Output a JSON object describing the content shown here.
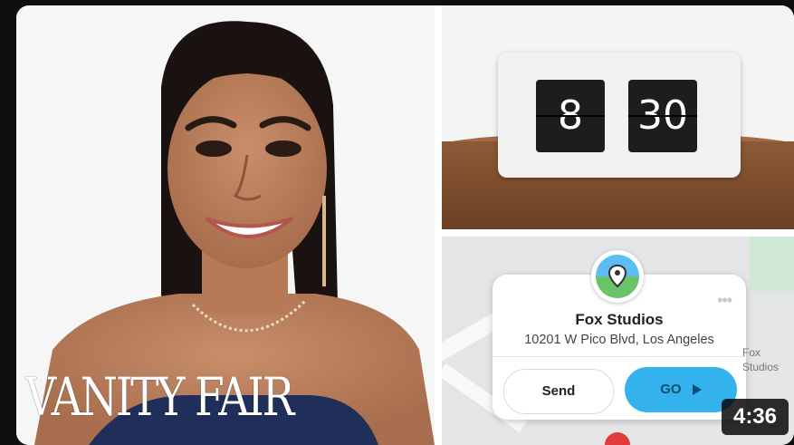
{
  "thumbnail": {
    "logo_text": "VANITY FAIR",
    "duration": "4:36"
  },
  "clock": {
    "hour": "8",
    "minute": "30"
  },
  "map": {
    "place_name": "Fox Studios",
    "address": "10201 W Pico Blvd, Los Angeles",
    "send_label": "Send",
    "go_label": "GO",
    "side_label_line1": "Fox",
    "side_label_line2": "Studios"
  },
  "colors": {
    "go_button": "#33b2ee",
    "badge_bg": "#000000"
  }
}
